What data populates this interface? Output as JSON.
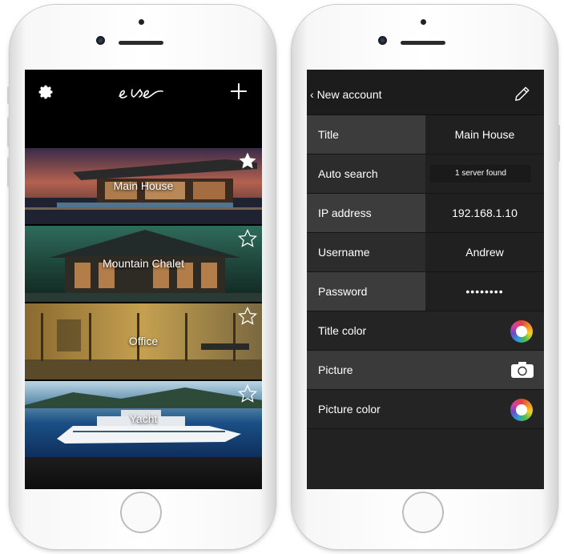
{
  "left_app": {
    "logo_text": "eve",
    "places": [
      {
        "label": "Main House",
        "favorite": true
      },
      {
        "label": "Mountain Chalet",
        "favorite": false
      },
      {
        "label": "Office",
        "favorite": false
      },
      {
        "label": "Yacht",
        "favorite": false
      }
    ]
  },
  "right_app": {
    "nav": {
      "back_label": "New account"
    },
    "rows": [
      {
        "label": "Title",
        "value": "Main House"
      },
      {
        "label": "Auto search",
        "value": "1 server found"
      },
      {
        "label": "IP address",
        "value": "192.168.1.10"
      },
      {
        "label": "Username",
        "value": "Andrew"
      },
      {
        "label": "Password",
        "value": "••••••••"
      },
      {
        "label": "Title color"
      },
      {
        "label": "Picture"
      },
      {
        "label": "Picture color"
      }
    ]
  },
  "colors": {
    "app_background": "#000000",
    "row_label_bg": "#3c3c3c",
    "row_value_bg": "#202020"
  },
  "icons": [
    "gear-icon",
    "plus-icon",
    "star-icon",
    "back-chevron-icon",
    "pencil-icon",
    "color-wheel-icon",
    "camera-icon"
  ]
}
